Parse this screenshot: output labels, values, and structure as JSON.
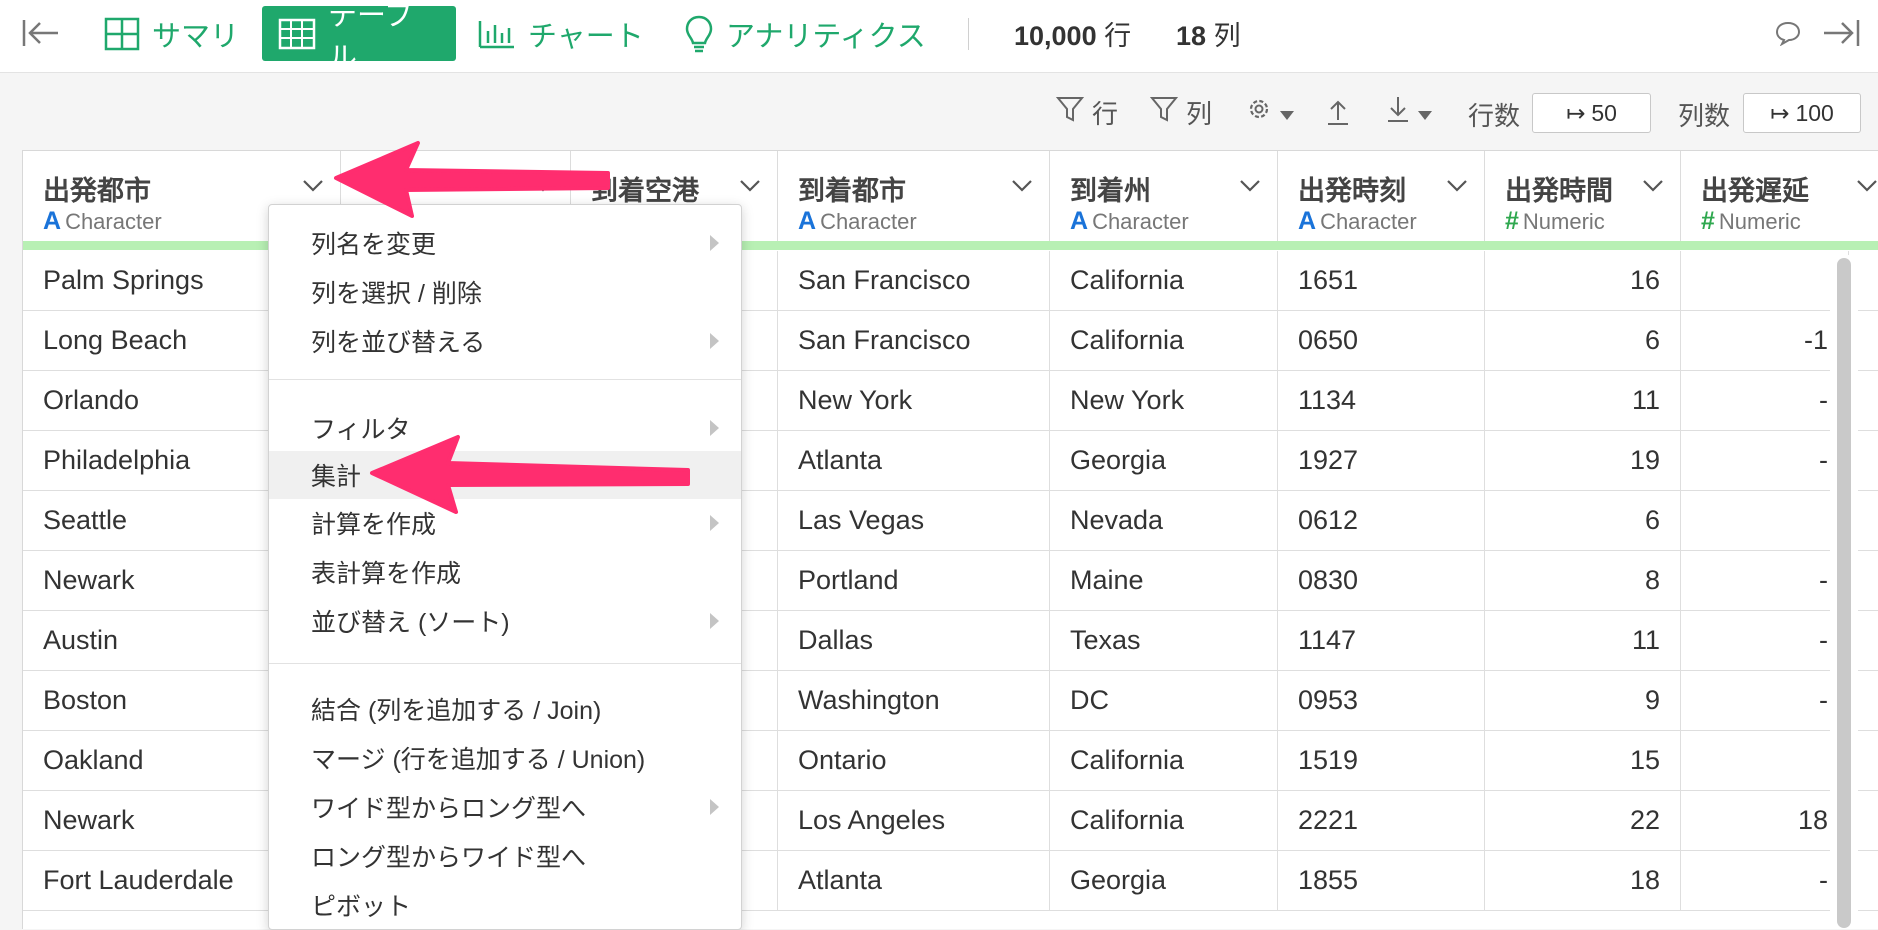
{
  "topbar": {
    "tabs": [
      {
        "label": "サマリ",
        "icon": "summary-grid-icon"
      },
      {
        "label": "テーブル",
        "icon": "table-icon",
        "active": true
      },
      {
        "label": "チャート",
        "icon": "chart-icon"
      },
      {
        "label": "アナリティクス",
        "icon": "lightbulb-icon"
      }
    ],
    "rows_value": "10,000",
    "rows_unit": "行",
    "cols_value": "18",
    "cols_unit": "列",
    "accent_color": "#1fa86c"
  },
  "toolbar": {
    "filter_rows_label": "行",
    "filter_cols_label": "列",
    "row_count_label": "行数",
    "row_count_value": "50",
    "col_count_label": "列数",
    "col_count_value": "100"
  },
  "table": {
    "columns": [
      {
        "name": "出発都市",
        "type": "Character"
      },
      {
        "name": "",
        "type": ""
      },
      {
        "name": "到着空港",
        "type": ""
      },
      {
        "name": "到着都市",
        "type": "Character"
      },
      {
        "name": "到着州",
        "type": "Character"
      },
      {
        "name": "出発時刻",
        "type": "Character"
      },
      {
        "name": "出発時間",
        "type": "Numeric"
      },
      {
        "name": "出発遅延",
        "type": "Numeric"
      }
    ],
    "rows": [
      {
        "origin_city": "Palm Springs",
        "dest_city": "San Francisco",
        "dest_state": "California",
        "dep_time": "1651",
        "dep_hour": "16",
        "dep_delay": ""
      },
      {
        "origin_city": "Long Beach",
        "dest_city": "San Francisco",
        "dest_state": "California",
        "dep_time": "0650",
        "dep_hour": "6",
        "dep_delay": "-1"
      },
      {
        "origin_city": "Orlando",
        "dest_city": "New York",
        "dest_state": "New York",
        "dep_time": "1134",
        "dep_hour": "11",
        "dep_delay": "-"
      },
      {
        "origin_city": "Philadelphia",
        "dest_city": "Atlanta",
        "dest_state": "Georgia",
        "dep_time": "1927",
        "dep_hour": "19",
        "dep_delay": "-"
      },
      {
        "origin_city": "Seattle",
        "dest_city": "Las Vegas",
        "dest_state": "Nevada",
        "dep_time": "0612",
        "dep_hour": "6",
        "dep_delay": ""
      },
      {
        "origin_city": "Newark",
        "dest_city": "Portland",
        "dest_state": "Maine",
        "dep_time": "0830",
        "dep_hour": "8",
        "dep_delay": "-"
      },
      {
        "origin_city": "Austin",
        "dest_city": "Dallas",
        "dest_state": "Texas",
        "dep_time": "1147",
        "dep_hour": "11",
        "dep_delay": "-"
      },
      {
        "origin_city": "Boston",
        "dest_city": "Washington",
        "dest_state": "DC",
        "dep_time": "0953",
        "dep_hour": "9",
        "dep_delay": "-"
      },
      {
        "origin_city": "Oakland",
        "dest_city": "Ontario",
        "dest_state": "California",
        "dep_time": "1519",
        "dep_hour": "15",
        "dep_delay": ""
      },
      {
        "origin_city": "Newark",
        "dest_city": "Los Angeles",
        "dest_state": "California",
        "dep_time": "2221",
        "dep_hour": "22",
        "dep_delay": "18"
      },
      {
        "origin_city": "Fort Lauderdale",
        "dest_city": "Atlanta",
        "dest_state": "Georgia",
        "dep_time": "1855",
        "dep_hour": "18",
        "dep_delay": "-"
      }
    ]
  },
  "context_menu": {
    "items": [
      {
        "label": "列名を変更",
        "submenu": true
      },
      {
        "label": "列を選択 / 削除",
        "submenu": false
      },
      {
        "label": "列を並び替える",
        "submenu": true
      },
      {
        "label": "フィルタ",
        "submenu": true
      },
      {
        "label": "集計",
        "submenu": false,
        "highlighted": true
      },
      {
        "label": "計算を作成",
        "submenu": true
      },
      {
        "label": "表計算を作成",
        "submenu": false
      },
      {
        "label": "並び替え (ソート)",
        "submenu": true
      },
      {
        "label": "結合 (列を追加する / Join)",
        "submenu": false
      },
      {
        "label": "マージ (行を追加する / Union)",
        "submenu": false
      },
      {
        "label": "ワイド型からロング型へ",
        "submenu": true
      },
      {
        "label": "ロング型からワイド型へ",
        "submenu": false
      },
      {
        "label": "ピボット",
        "submenu": false
      }
    ]
  },
  "annotation_color": "#ff2d6f"
}
